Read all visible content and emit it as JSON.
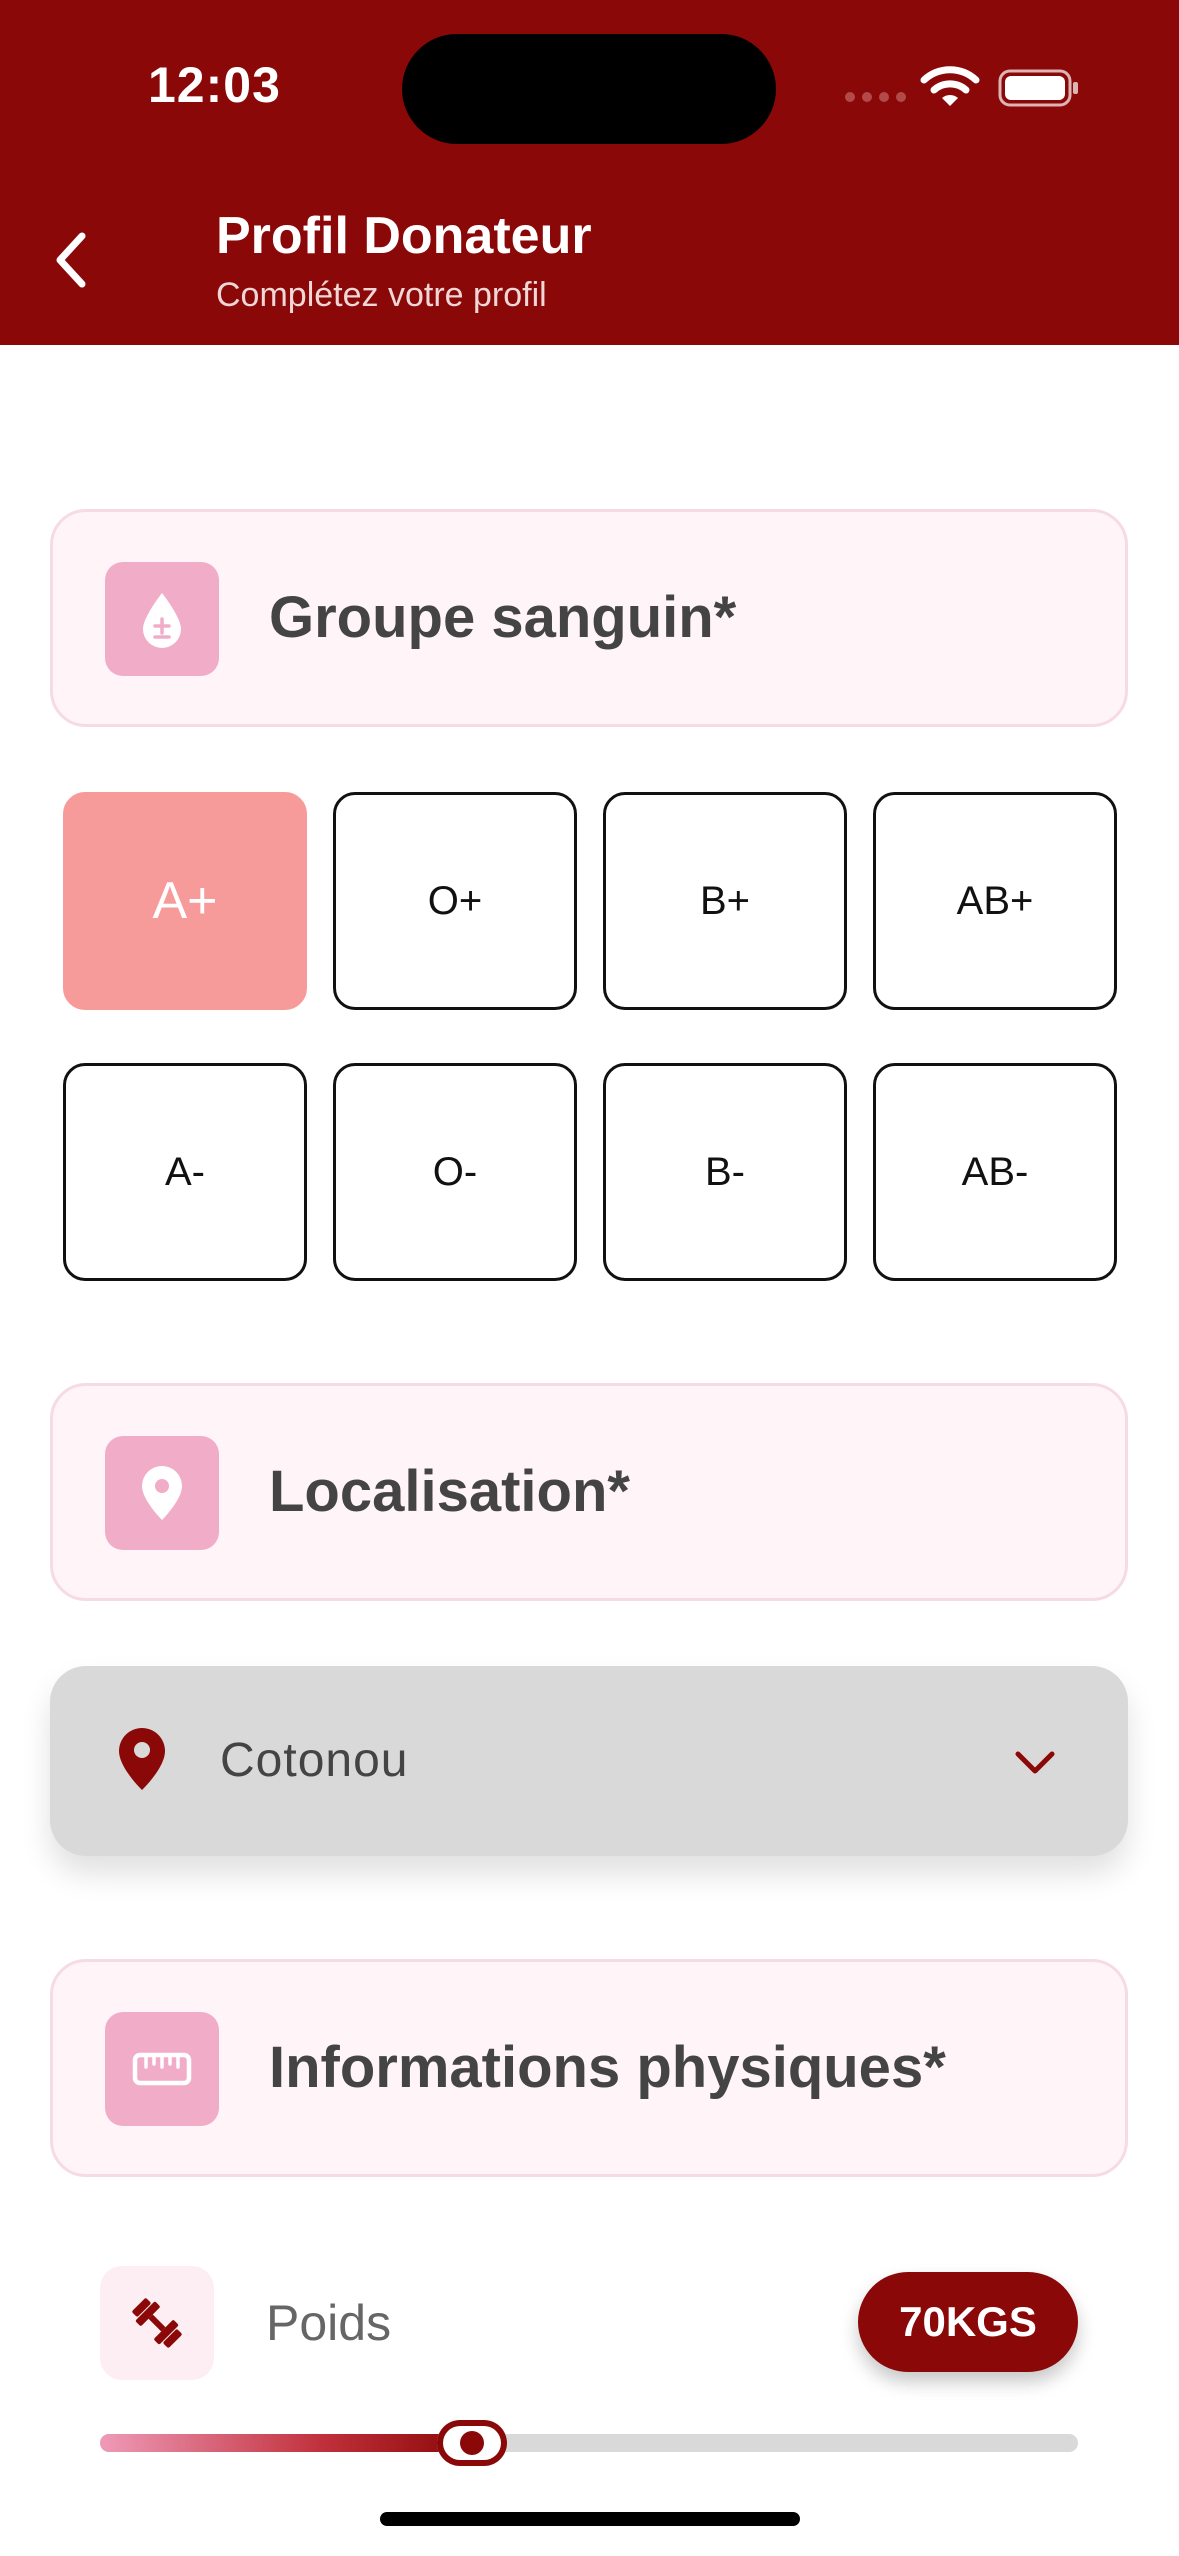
{
  "status_bar": {
    "time": "12:03"
  },
  "header": {
    "title": "Profil Donateur",
    "subtitle": "Complétez votre profil"
  },
  "sections": {
    "blood": {
      "label": "Groupe sanguin*",
      "icon": "blood-drop-icon"
    },
    "location": {
      "label": "Localisation*",
      "icon": "location-pin-icon"
    },
    "physical": {
      "label": "Informations physiques*",
      "icon": "ruler-icon"
    }
  },
  "blood_types": [
    {
      "label": "A+",
      "selected": true
    },
    {
      "label": "O+",
      "selected": false
    },
    {
      "label": "B+",
      "selected": false
    },
    {
      "label": "AB+",
      "selected": false
    },
    {
      "label": "A-",
      "selected": false
    },
    {
      "label": "O-",
      "selected": false
    },
    {
      "label": "B-",
      "selected": false
    },
    {
      "label": "AB-",
      "selected": false
    }
  ],
  "location": {
    "selected": "Cotonou"
  },
  "weight": {
    "label": "Poids",
    "badge": "70KGS",
    "slider_fraction": 0.38
  },
  "colors": {
    "brand": "#8a0808",
    "selected_blood": "#f79a9a",
    "section_bg": "#fff4f7",
    "section_icon_bg": "#f1adc8"
  }
}
